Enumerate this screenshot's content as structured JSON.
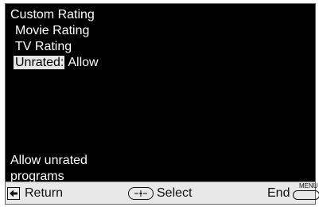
{
  "menu": {
    "title": "Custom Rating",
    "items": [
      {
        "label": "Movie Rating"
      },
      {
        "label": "TV Rating"
      },
      {
        "label": "Unrated:",
        "value": "Allow"
      }
    ]
  },
  "help_text": [
    "Allow unrated",
    "programs"
  ],
  "footer": {
    "return_label": "Return",
    "select_label": "Select",
    "end_label": "End",
    "menu_button_label": "MENU"
  },
  "icons": {
    "return": "left-arrow-icon",
    "select": "joystick-icon",
    "menu": "menu-button-icon"
  },
  "colors": {
    "screen_bg": "#000000",
    "highlight_bg": "#e6e6e6",
    "footer_bg": "#e8e8e8"
  }
}
